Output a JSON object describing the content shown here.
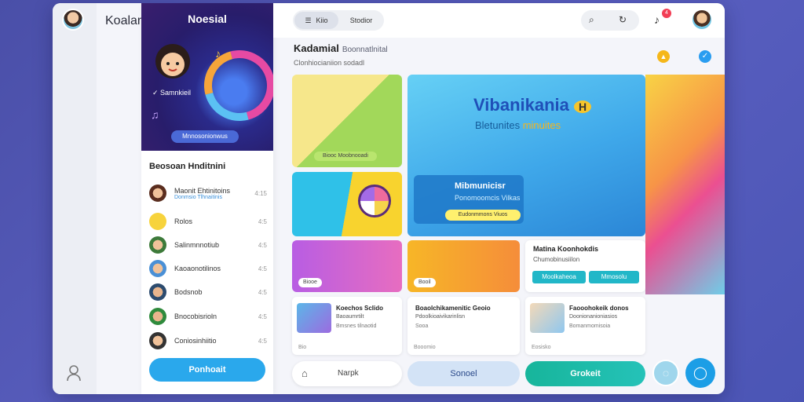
{
  "app": {
    "title": "Koalan"
  },
  "hero": {
    "title": "Noesial",
    "subtitle": "Samnkieil",
    "pill": "Mnnosonionwus"
  },
  "contacts": {
    "title": "Beosoan Hnditnini",
    "items": [
      {
        "name": "Maonit Ehtinitoins",
        "sub": "Donmsio Tlhnaitinis",
        "meta": "4:15"
      },
      {
        "name": "Rolos",
        "sub": "",
        "meta": "4:5"
      },
      {
        "name": "Salinmnnotiub",
        "sub": "",
        "meta": "4:5"
      },
      {
        "name": "Kaoaonotilinos",
        "sub": "",
        "meta": "4:5"
      },
      {
        "name": "Bodsnob",
        "sub": "",
        "meta": "4:5"
      },
      {
        "name": "Bnocobisrioln",
        "sub": "",
        "meta": "4:5"
      },
      {
        "name": "Coniosinhiitio",
        "sub": "",
        "meta": "4:5"
      }
    ],
    "primary_button": "Ponhoait"
  },
  "topbar": {
    "tab1": "Kiio",
    "tab2": "Stodior",
    "badge": "4"
  },
  "heading": {
    "title": "Kadamial",
    "title_extra": "Boonnatlnital",
    "subtitle": "Clonhiocianiion sodadl"
  },
  "tiles": {
    "t1_label": "Biooc Moobnooadi",
    "feature": {
      "title": "Vibanikania",
      "title_badge": "H",
      "subtitle": "Bletunites",
      "subtitle_highlight": "minuites",
      "inner_title": "Mibmunicisr",
      "inner_sub": "Ponomoomcis Vilkas",
      "inner_pill": "Eudonmmons Viuos"
    },
    "t5_label": "Biooe",
    "t6_label": "Booil",
    "promo": {
      "title": "Matina Koonhokdis",
      "sub": "Chumobinusiilon",
      "btn1": "Moolkaheoa",
      "btn2": "Mmosolu"
    }
  },
  "cards": [
    {
      "title": "Koechos Sclido",
      "sub": "Baoaumrtilt",
      "extra": "Bmsnes tilnaotid",
      "foot": "Bio"
    },
    {
      "title": "Boaolchikamenitic Geoio",
      "sub": "Pdoolkioaivikarinlisn",
      "extra": "Sooa",
      "foot": "Booomio"
    },
    {
      "title": "Faooohokeik donos",
      "sub": "Doonionanioniasios",
      "extra": "Bomanmomisoia",
      "foot": "Eosisko"
    }
  ],
  "bottom": {
    "search_placeholder": "Narpk",
    "soft_button": "Sonoel",
    "teal_button": "Grokeit"
  }
}
